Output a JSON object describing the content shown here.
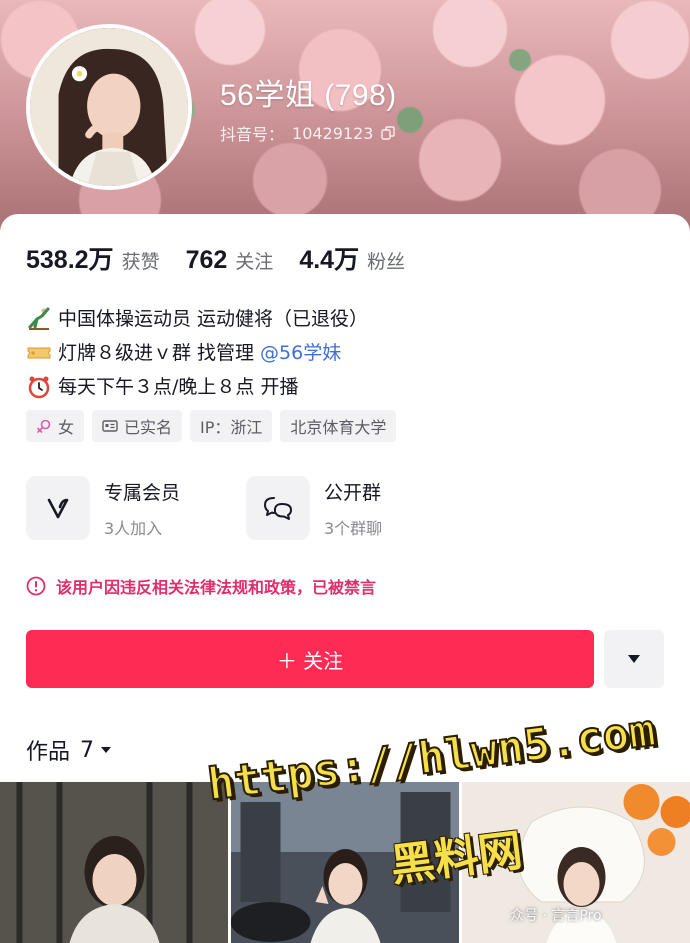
{
  "profile": {
    "nickname": "56学姐 (798)",
    "douyin_id_label": "抖音号：",
    "douyin_id": "10429123"
  },
  "stats": [
    {
      "value": "538.2万",
      "label": "获赞"
    },
    {
      "value": "762",
      "label": "关注"
    },
    {
      "value": "4.4万",
      "label": "粉丝"
    }
  ],
  "bio": {
    "line1": "中国体操运动员 运动健将（已退役）",
    "line2_prefix": "灯牌８级进ｖ群 找管理",
    "line2_mention": "@56学妹",
    "line3": "每天下午３点/晚上８点 开播"
  },
  "tags": {
    "gender": "女",
    "verified": "已实名",
    "ip": "IP：浙江",
    "school": "北京体育大学"
  },
  "features": [
    {
      "title": "专属会员",
      "sub": "3人加入"
    },
    {
      "title": "公开群",
      "sub": "3个群聊"
    }
  ],
  "ban_notice": "该用户因违反相关法律法规和政策，已被禁言",
  "follow_label": "＋ 关注",
  "works": {
    "label": "作品",
    "count": "7"
  },
  "watermark": {
    "url": "https://hlwn5.com",
    "name": "黑料网",
    "credit": "众号 · 言言Pro"
  },
  "colors": {
    "follow_button": "#fe2c55",
    "ban_text": "#e02d6b",
    "mention": "#3f6fd1"
  }
}
